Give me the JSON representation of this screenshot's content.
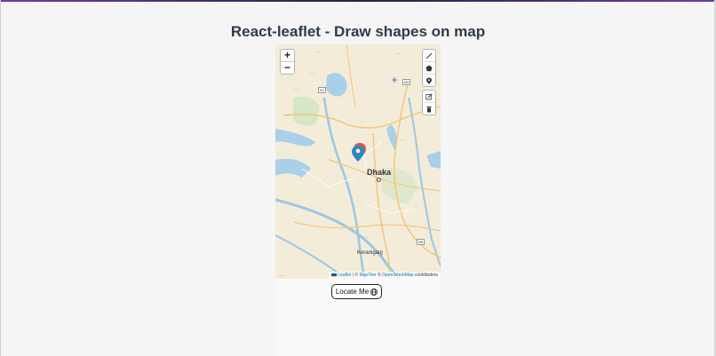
{
  "page": {
    "title": "React-leaflet - Draw shapes on map"
  },
  "map": {
    "zoom_in_label": "+",
    "zoom_out_label": "−",
    "city_label": "Dhaka",
    "town_label": "Keraniganj",
    "road_labels": [
      "N1",
      "N3",
      "N5"
    ],
    "attribution": {
      "leaflet": "Leaflet",
      "separator": "| ©",
      "maptiler": "MapTiler",
      "osm_prefix": "©",
      "osm": "OpenStreetMap",
      "suffix": "contributors"
    },
    "draw_tools": [
      "polyline-icon",
      "polygon-icon",
      "marker-icon"
    ],
    "edit_tools": [
      "edit-icon",
      "trash-icon"
    ],
    "colors": {
      "water": "#a9d0e8",
      "marker": "#2e86c1",
      "marker_red": "#d9534f",
      "road": "#f2c77a"
    }
  },
  "locate_button": {
    "label": "Locate Me"
  }
}
